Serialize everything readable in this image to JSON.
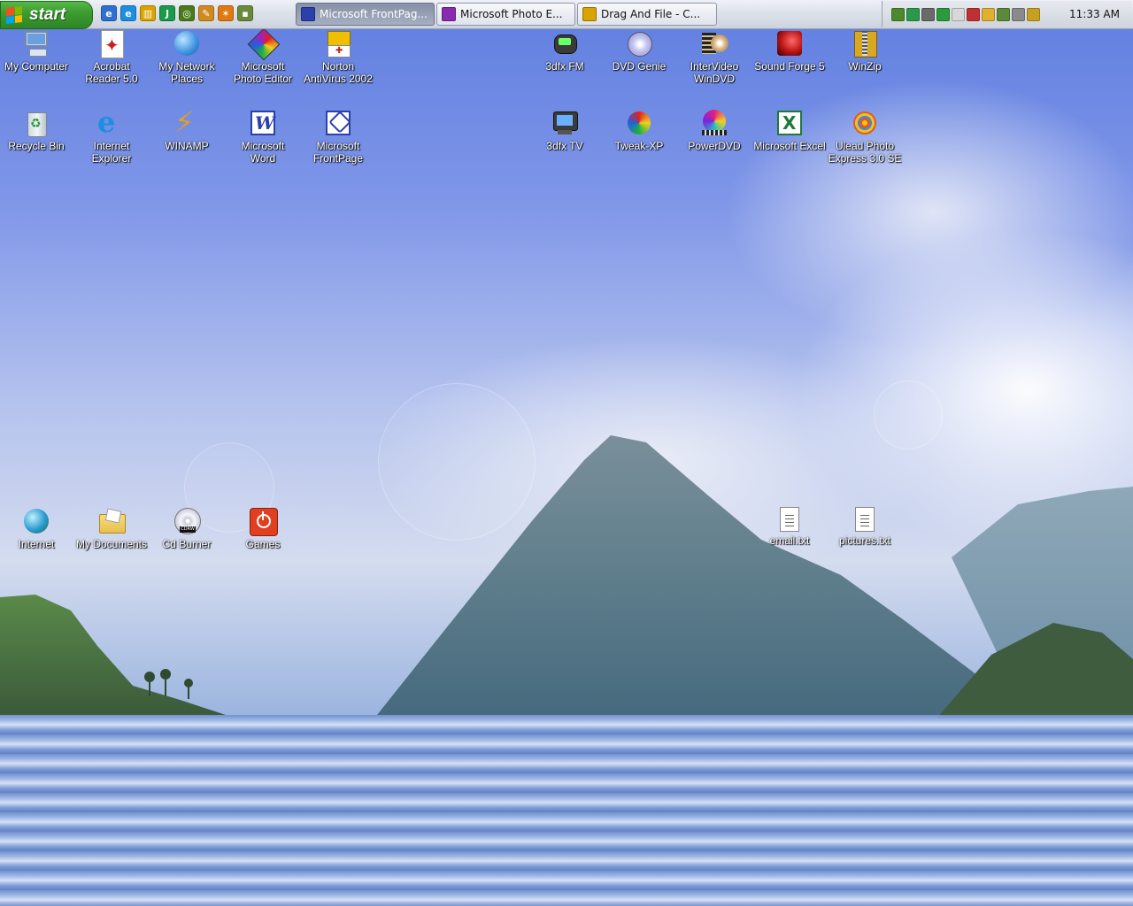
{
  "taskbar": {
    "start_label": "start",
    "quick_launch": [
      {
        "icon": "outlook-express-icon",
        "glyph": "e",
        "color": "#2f6fcf"
      },
      {
        "icon": "internet-explorer-icon",
        "glyph": "e",
        "color": "#1c8fe0"
      },
      {
        "icon": "drag-and-file-icon",
        "glyph": "▥",
        "color": "#d9a300"
      },
      {
        "icon": "winamp-j-icon",
        "glyph": "J",
        "color": "#1a9a4a"
      },
      {
        "icon": "media-player-icon",
        "glyph": "◎",
        "color": "#4a7a1a"
      },
      {
        "icon": "pencil-icon",
        "glyph": "✎",
        "color": "#d08a20"
      },
      {
        "icon": "running-man-icon",
        "glyph": "✶",
        "color": "#e07a10"
      },
      {
        "icon": "desktop-show-icon",
        "glyph": "▪",
        "color": "#6a8a3a"
      }
    ],
    "tasks": [
      {
        "label": "Microsoft FrontPag...",
        "icon": "frontpage-icon",
        "color": "#2b3fae",
        "active": true
      },
      {
        "label": "Microsoft Photo E...",
        "icon": "photo-editor-icon",
        "color": "#8a2ab0",
        "active": false
      },
      {
        "label": "Drag And File  -  C...",
        "icon": "drag-and-file-icon",
        "color": "#d9a300",
        "active": false
      }
    ],
    "tray_icons": [
      {
        "icon": "tray-app-icon-1",
        "color": "#4b8a2a"
      },
      {
        "icon": "tray-network-icon",
        "color": "#2a9a4a"
      },
      {
        "icon": "tray-shield-icon",
        "color": "#6a6a6a"
      },
      {
        "icon": "tray-display-icon",
        "color": "#2a9a3a"
      },
      {
        "icon": "tray-mouse-icon",
        "color": "#d8d8d8"
      },
      {
        "icon": "tray-antivirus-icon",
        "color": "#c03030"
      },
      {
        "icon": "tray-folder-icon",
        "color": "#e0b030"
      },
      {
        "icon": "tray-sound-icon",
        "color": "#5a8a3a"
      },
      {
        "icon": "tray-checker-icon",
        "color": "#8a8a8a"
      },
      {
        "icon": "tray-arrow-icon",
        "color": "#c8a020"
      }
    ],
    "clock": "11:33 AM"
  },
  "desktop": {
    "icons": [
      {
        "label": "My Computer",
        "icon": "my-computer-icon",
        "color": "#6aa0e0"
      },
      {
        "label": "Acrobat\nReader 5.0",
        "icon": "acrobat-reader-icon",
        "color": "#c82020"
      },
      {
        "label": "My Network\nPlaces",
        "icon": "network-places-icon",
        "color": "#3a90e0"
      },
      {
        "label": "Microsoft\nPhoto Editor",
        "icon": "photo-editor-icon",
        "color": "#8a2ab0"
      },
      {
        "label": "Norton\nAntiVirus 2002",
        "icon": "norton-antivirus-icon",
        "color": "#f0c000"
      },
      {
        "label": "3dfx FM",
        "icon": "3dfx-fm-icon",
        "color": "#3a3a3a"
      },
      {
        "label": "DVD Genie",
        "icon": "dvd-genie-icon",
        "color": "#a0a0e0"
      },
      {
        "label": "InterVideo\nWinDVD",
        "icon": "windvd-icon",
        "color": "#4a3a2a"
      },
      {
        "label": "Sound Forge 5",
        "icon": "sound-forge-icon",
        "color": "#c01818"
      },
      {
        "label": "WinZip",
        "icon": "winzip-icon",
        "color": "#d8a820"
      },
      {
        "label": "Recycle Bin",
        "icon": "recycle-bin-icon",
        "color": "#5aa05a"
      },
      {
        "label": "Internet\nExplorer",
        "icon": "internet-explorer-icon",
        "color": "#1c8fe0"
      },
      {
        "label": "WINAMP",
        "icon": "winamp-icon",
        "color": "#e0a020"
      },
      {
        "label": "Microsoft\nWord",
        "icon": "word-icon",
        "color": "#2b3fae"
      },
      {
        "label": "Microsoft\nFrontPage",
        "icon": "frontpage-icon",
        "color": "#2b3fae"
      },
      {
        "label": "3dfx TV",
        "icon": "3dfx-tv-icon",
        "color": "#3a3a3a"
      },
      {
        "label": "Tweak-XP",
        "icon": "tweak-xp-icon",
        "color": "#e0a020"
      },
      {
        "label": "PowerDVD",
        "icon": "powerdvd-icon",
        "color": "#c03080"
      },
      {
        "label": "Microsoft Excel",
        "icon": "excel-icon",
        "color": "#1e7a3a"
      },
      {
        "label": "Ulead Photo\nExpress 3.0 SE",
        "icon": "ulead-photo-express-icon",
        "color": "#e07a20"
      },
      {
        "label": "Internet",
        "icon": "internet-globe-icon",
        "color": "#2a9ad0"
      },
      {
        "label": "My Documents",
        "icon": "my-documents-icon",
        "color": "#e8c050"
      },
      {
        "label": "Cd Burner",
        "icon": "cd-burner-icon",
        "color": "#c8c8d8"
      },
      {
        "label": "Games",
        "icon": "games-icon",
        "color": "#e04020"
      },
      {
        "label": "email.txt",
        "icon": "text-file-icon",
        "color": "#ffffff"
      },
      {
        "label": "pictures.txt",
        "icon": "text-file-icon",
        "color": "#ffffff"
      }
    ]
  }
}
